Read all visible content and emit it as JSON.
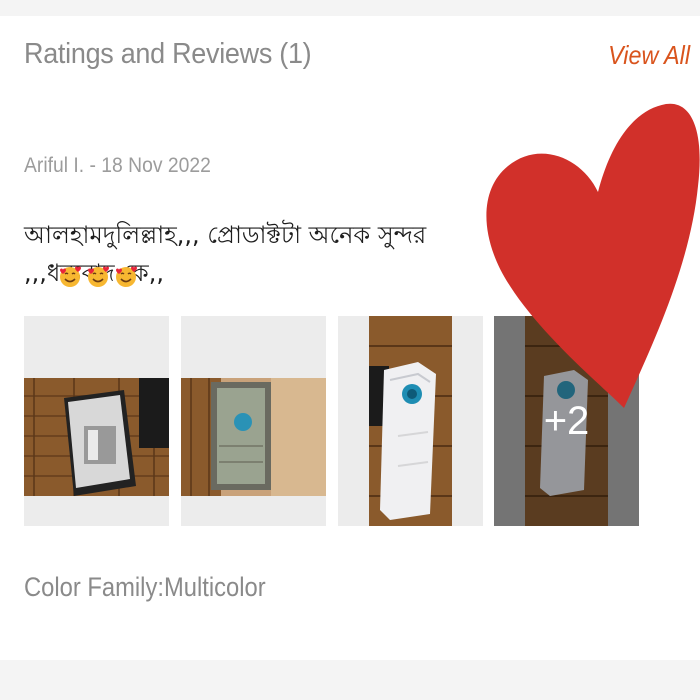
{
  "section": {
    "title": "Ratings and Reviews (1)",
    "view_all_label": "View All"
  },
  "review": {
    "author_line": "Ariful I. - 18 Nov 2022",
    "text": "আলহামদুলিল্লাহ,,, প্রোডাক্টটা অনেক সুন্দর ,,,ধন্যবাদ কে,,",
    "emojis": [
      "smiling-face-with-hearts",
      "smiling-face-with-hearts",
      "smiling-face-with-hearts"
    ],
    "photos_extra_count": "+2",
    "sku": "Color Family:Multicolor"
  },
  "colors": {
    "accent": "#d9541d",
    "heart": "#d1302a",
    "title_gray": "#8a8a8a"
  },
  "icons": {
    "overlay": "heart-icon"
  }
}
